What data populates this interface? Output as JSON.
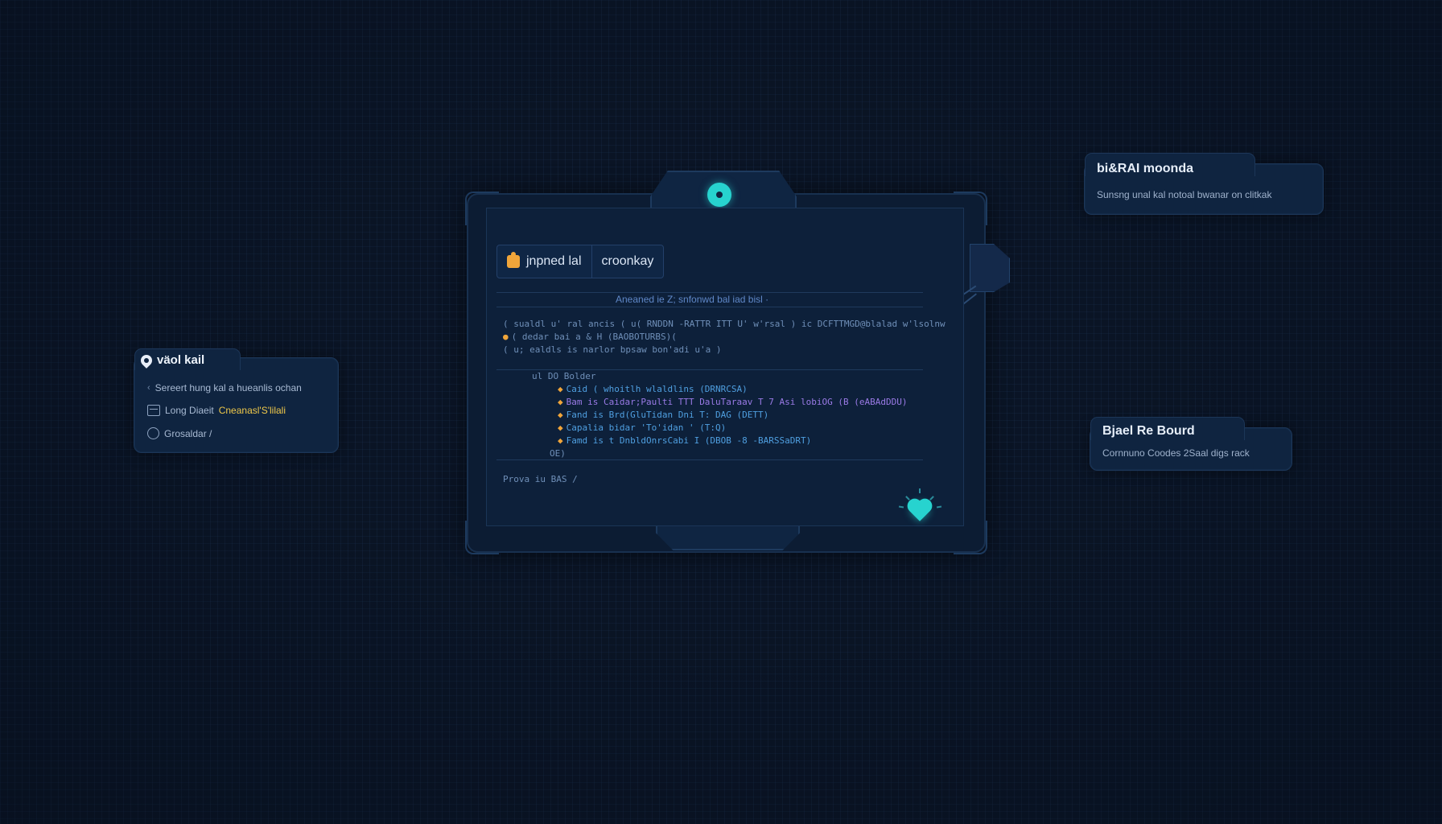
{
  "editor": {
    "tabs": [
      {
        "label": "jnpned lal",
        "icon": "puzzle-icon"
      },
      {
        "label": "croonkay"
      }
    ],
    "comment": "Aneaned ie Z; snfonwd bal iad bisl ·",
    "code_lines": [
      "( sualdl u' ral ancis ( u( RNDDN -RATTR  ITT U' w'rsal ) ic DCFTTMGD@blalad w'lsolnw",
      "( dedar bai a & H (BAOBOTURBS)(",
      "( u; ealdls is narlor bpsaw bon'adi u'a )",
      "ul DO Bolder",
      "Caid ( whoitlh wlaldlins (DRNRCSA)",
      "Bam is Caidar;Paulti  TTT  DaluTaraav T 7 Asi lobiOG  (B (eABAdDDU)",
      "Fand is Brd(GluTidan Dni T: DAG (DETT)",
      "Capalia bidar  'To'idan ' (T:Q)",
      "Famd is t DnbldOnrsCabi I (DBOB -8 -BARSSaDRT)",
      "OE)",
      "Prova iu BAS /"
    ]
  },
  "left_card": {
    "title": "väol kail",
    "line1": "Sereert hung kal a hueanlis ochan",
    "line2_label": "Long Diaeit",
    "line2_value": "Cneanasl'S'lilali",
    "line3": "Grosaldar /"
  },
  "right_card_1": {
    "title": "bi&RAI moonda",
    "desc": "Sunsng unal kal notoal bwanar on clitkak"
  },
  "right_card_2": {
    "title": "Bjael Re Bourd",
    "desc": "Cornnuno Coodes 2Saal digs rack"
  },
  "colors": {
    "background": "#0b1628",
    "accent_teal": "#27d3cf",
    "accent_orange": "#f0a53a",
    "highlight_yellow": "#f0c94a"
  }
}
